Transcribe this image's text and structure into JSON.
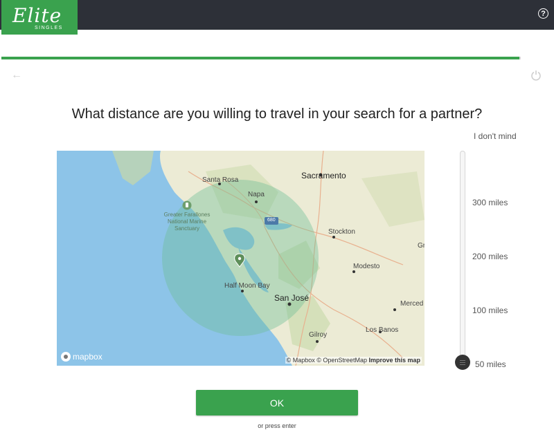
{
  "header": {
    "logo_main": "Elite",
    "logo_sub": "SINGLES",
    "help_icon": "?"
  },
  "progress": {
    "fraction": 0.997
  },
  "question": "What distance are you willing to travel in your search for a partner?",
  "map": {
    "places": [
      {
        "name": "Sacramento",
        "big": true
      },
      {
        "name": "Santa Rosa",
        "big": false
      },
      {
        "name": "Napa",
        "big": false
      },
      {
        "name": "Stockton",
        "big": false
      },
      {
        "name": "Modesto",
        "big": false
      },
      {
        "name": "Half Moon Bay",
        "big": false
      },
      {
        "name": "San José",
        "big": true
      },
      {
        "name": "Merced",
        "big": false
      },
      {
        "name": "Los Banos",
        "big": false
      },
      {
        "name": "Gilroy",
        "big": false
      },
      {
        "name": "Gr",
        "big": false
      }
    ],
    "sanctuary": "Greater Farallones National Marine Sanctuary",
    "highway": "680",
    "logo": "mapbox",
    "attribution_1": "© Mapbox",
    "attribution_2": "© OpenStreetMap",
    "attribution_3": "Improve this map"
  },
  "slider": {
    "ticks": [
      "I don't mind",
      "300 miles",
      "200 miles",
      "100 miles",
      "50 miles"
    ],
    "selected": "50 miles"
  },
  "ok_label": "OK",
  "hint": "or press enter",
  "colors": {
    "brand_green": "#3aa24e",
    "topbar": "#2d3038"
  }
}
